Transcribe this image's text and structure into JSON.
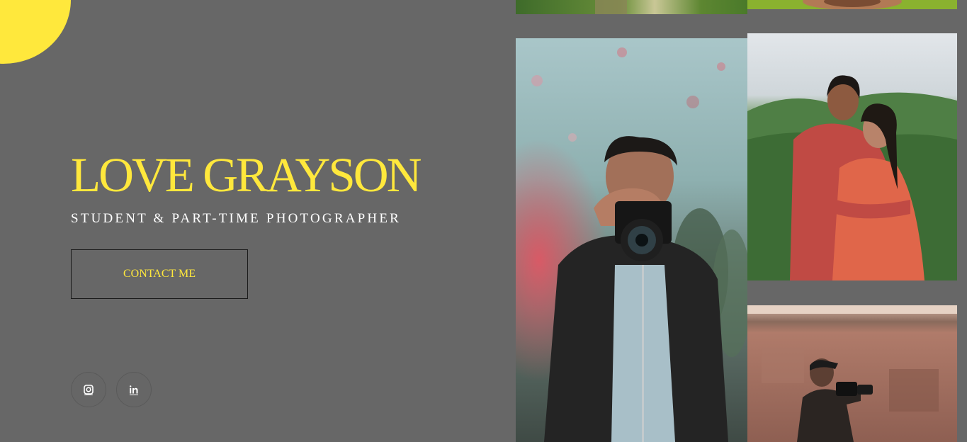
{
  "menu": {
    "icon": "hamburger-menu-icon",
    "accent_color": "#ffe83c"
  },
  "hero": {
    "title": "LOVE GRAYSON",
    "subtitle": "STUDENT & PART-TIME PHOTOGRAPHER",
    "contact_label": "CONTACT ME"
  },
  "socials": [
    {
      "icon": "instagram-icon"
    },
    {
      "icon": "linkedin-icon"
    }
  ],
  "gallery": [
    {
      "subject": "forest-trunk-photo"
    },
    {
      "subject": "portrait-photo"
    },
    {
      "subject": "photographer-with-camera-photo"
    },
    {
      "subject": "couple-embrace-photo"
    },
    {
      "subject": "street-photographer-photo"
    }
  ],
  "colors": {
    "background": "#676767",
    "accent": "#ffe83c",
    "text": "#ffffff"
  }
}
